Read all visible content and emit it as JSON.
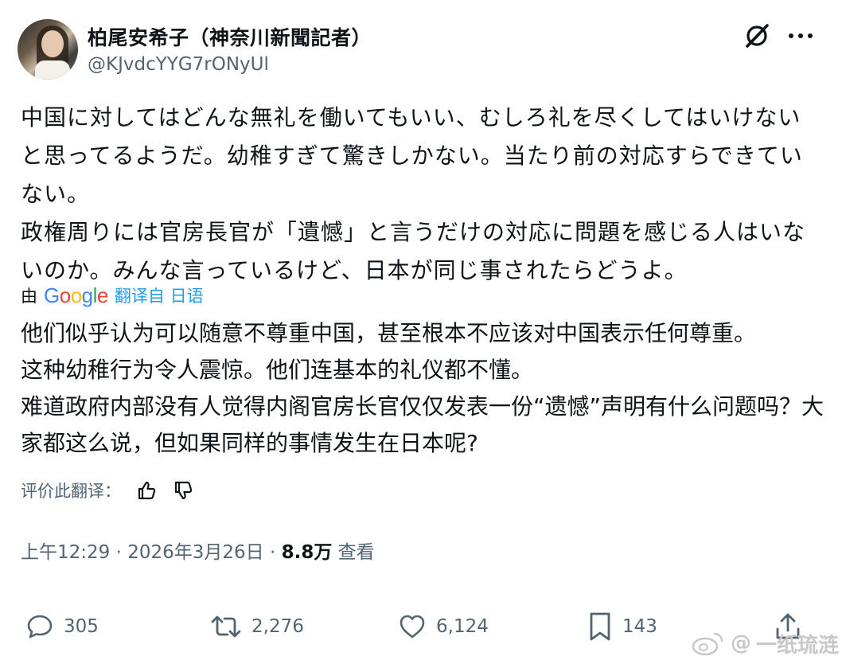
{
  "author": {
    "display_name": "柏尾安希子（神奈川新聞記者）",
    "handle": "@KJvdcYYG7rONyUl"
  },
  "header_icons": [
    "grok-icon",
    "more-icon"
  ],
  "tweet": {
    "text": "中国に対してはどんな無礼を働いてもいい、むしろ礼を尽くしてはいけないと思ってるようだ。幼稚すぎて驚きしかない。当たり前の対応すらできていない。\n政権周りには官房長官が「遺憾」と言うだけの対応に問題を感じる人はいないのか。みんな言っているけど、日本が同じ事されたらどうよ。"
  },
  "translation": {
    "by_label": "由",
    "provider": "Google",
    "link_label": "翻译自 日语",
    "text": "他们似乎认为可以随意不尊重中国，甚至根本不应该对中国表示任何尊重。\n这种幼稚行为令人震惊。他们连基本的礼仪都不懂。\n难道政府内部没有人觉得内阁官房长官仅仅发表一份“遗憾”声明有什么问题吗？大家都这么说，但如果同样的事情发生在日本呢?",
    "rate_label": "评价此翻译："
  },
  "meta": {
    "time": "上午12:29",
    "sep": " · ",
    "date": "2026年3月26日",
    "views_count": "8.8万",
    "views_label": "查看"
  },
  "actions": {
    "replies": "305",
    "reposts": "2,276",
    "likes": "6,124",
    "bookmarks": "143"
  },
  "watermark": {
    "text": "一纸琉涟"
  },
  "colors": {
    "text_primary": "#0f1419",
    "text_secondary": "#536471",
    "link": "#1d9bf0"
  }
}
